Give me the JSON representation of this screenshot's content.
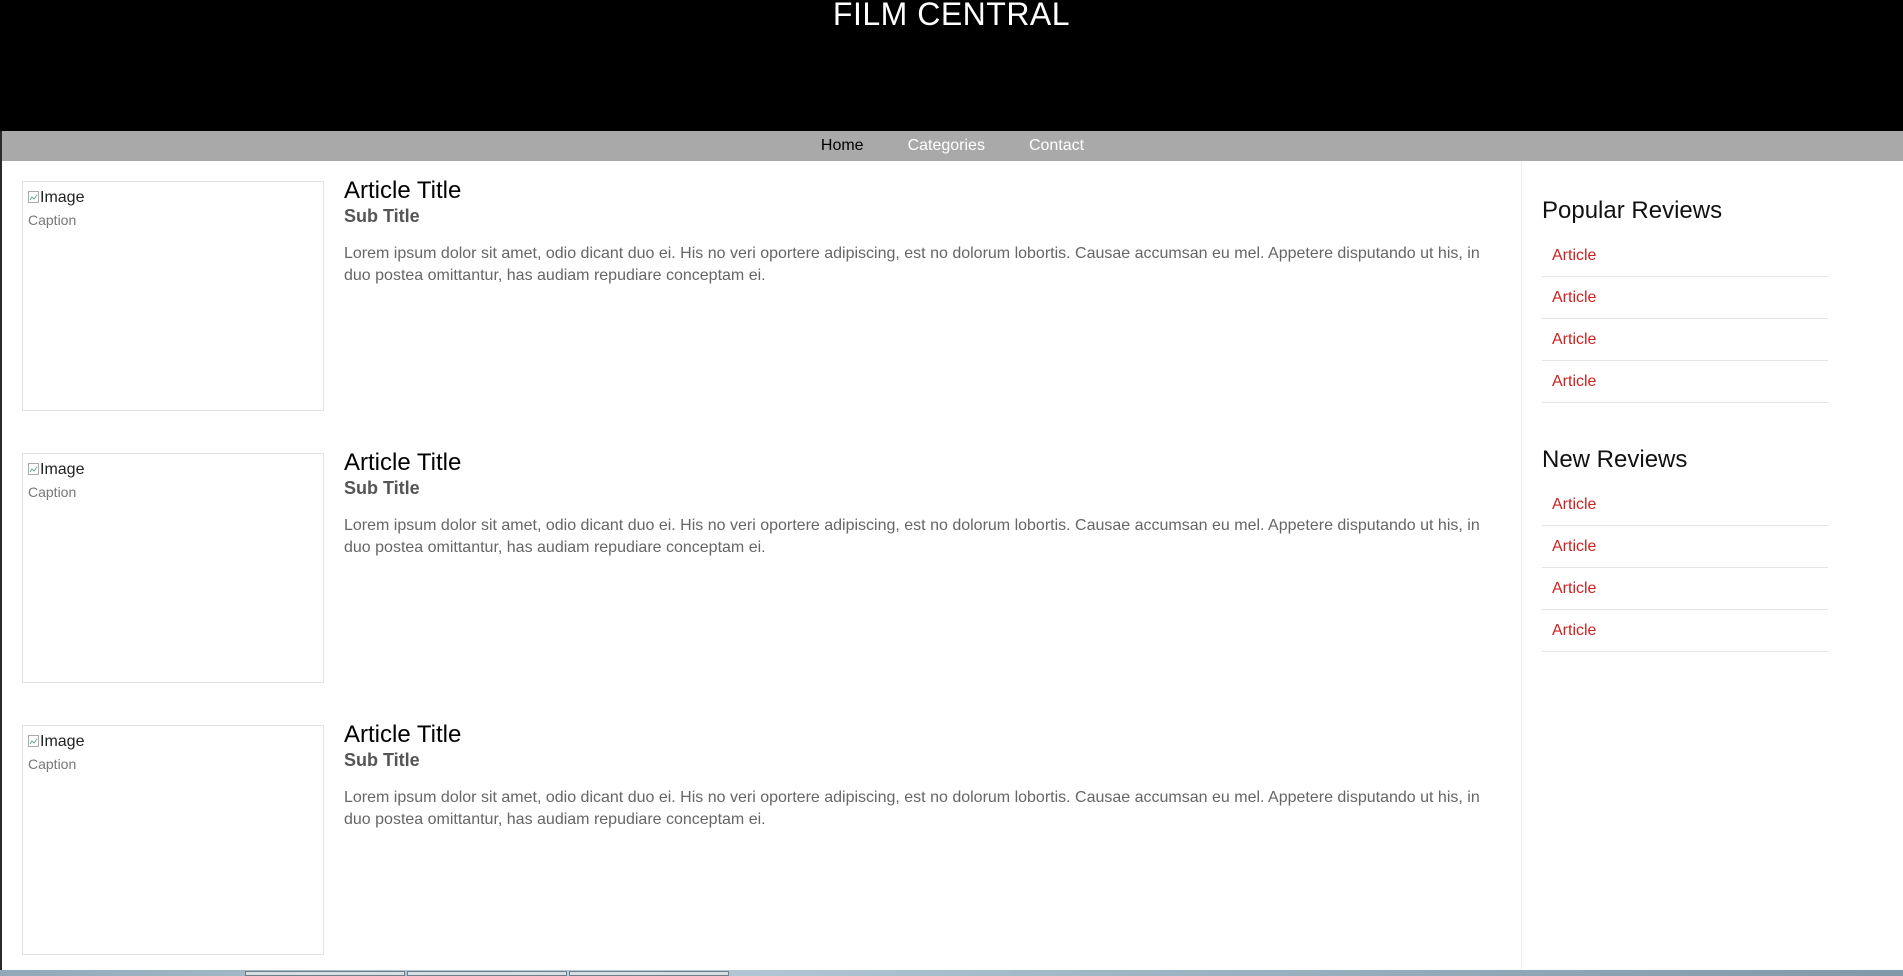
{
  "site": {
    "title": "FILM CENTRAL"
  },
  "nav": {
    "items": [
      {
        "label": "Home",
        "active": true
      },
      {
        "label": "Categories",
        "active": false
      },
      {
        "label": "Contact",
        "active": false
      }
    ]
  },
  "articles": [
    {
      "image_alt": "Image",
      "caption": "Caption",
      "title": "Article Title",
      "subtitle": "Sub Title",
      "text": "Lorem ipsum dolor sit amet, odio dicant duo ei. His no veri oportere adipiscing, est no dolorum lobortis. Causae accumsan eu mel. Appetere disputando ut his, in duo postea omittantur, has audiam repudiare conceptam ei."
    },
    {
      "image_alt": "Image",
      "caption": "Caption",
      "title": "Article Title",
      "subtitle": "Sub Title",
      "text": "Lorem ipsum dolor sit amet, odio dicant duo ei. His no veri oportere adipiscing, est no dolorum lobortis. Causae accumsan eu mel. Appetere disputando ut his, in duo postea omittantur, has audiam repudiare conceptam ei."
    },
    {
      "image_alt": "Image",
      "caption": "Caption",
      "title": "Article Title",
      "subtitle": "Sub Title",
      "text": "Lorem ipsum dolor sit amet, odio dicant duo ei. His no veri oportere adipiscing, est no dolorum lobortis. Causae accumsan eu mel. Appetere disputando ut his, in duo postea omittantur, has audiam repudiare conceptam ei."
    }
  ],
  "sidebar": {
    "popular": {
      "heading": "Popular Reviews",
      "items": [
        "Article",
        "Article",
        "Article",
        "Article"
      ]
    },
    "new": {
      "heading": "New Reviews",
      "items": [
        "Article",
        "Article",
        "Article",
        "Article"
      ]
    }
  },
  "colors": {
    "header_bg": "#000000",
    "nav_bg": "#a9a9a9",
    "link": "#cc2222"
  }
}
